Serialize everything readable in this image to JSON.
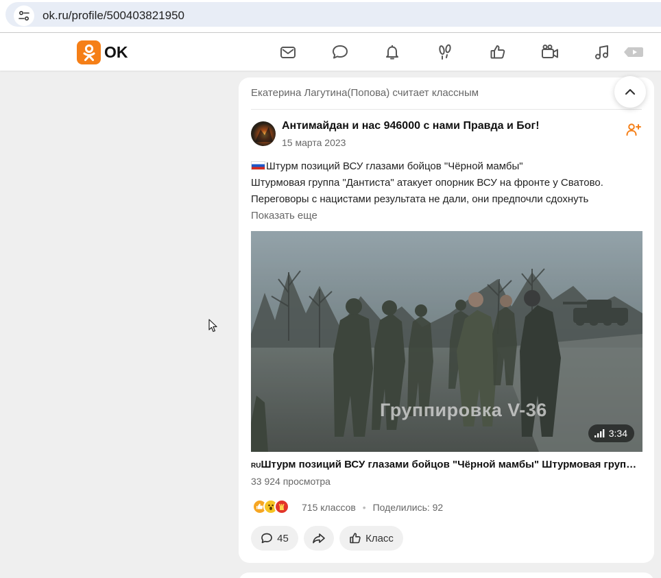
{
  "browser": {
    "url": "ok.ru/profile/500403821950"
  },
  "nav": {
    "logo_text": "OK",
    "icons": [
      "mail-icon",
      "chat-icon",
      "bell-icon",
      "footprints-icon",
      "like-icon",
      "video-icon",
      "music-icon",
      "video-play-icon"
    ]
  },
  "feed": {
    "context": "Екатерина Лагутина(Попова) считает классным",
    "post": {
      "author": "Антимайдан и нас 946000 с нами Правда и Бог!",
      "date": "15 марта 2023",
      "text_lines": [
        "Штурм позиций ВСУ глазами бойцов \"Чёрной мамбы\"",
        "Штурмовая группа \"Дантиста\" атакует опорник ВСУ на фронте у Сватово.",
        "Переговоры с нацистами результата не дали, они предпочли сдохнуть"
      ],
      "show_more": "Показать еще",
      "video": {
        "watermark": "Группировка V-36",
        "duration": "3:34",
        "title_prefix": "RU",
        "title": "Штурм позиций ВСУ глазами бойцов \"Чёрной мамбы\" Штурмовая группа \"Дантиста\" атакует опорник ВСУ на фронте у Сватово.",
        "views": "33 924 просмотра"
      },
      "reactions": {
        "classes": "715 классов",
        "separator": "•",
        "shared": "Поделились: 92"
      },
      "actions": {
        "comments_count": "45",
        "class_label": "Класс"
      }
    }
  },
  "colors": {
    "brand": "#f57f17",
    "card_bg": "#ffffff",
    "page_bg": "#efefef"
  }
}
